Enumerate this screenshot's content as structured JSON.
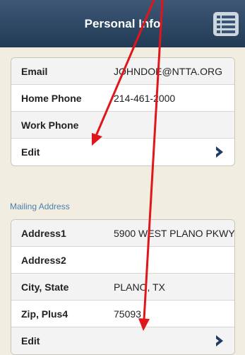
{
  "header": {
    "title": "Personal Info",
    "menu_icon": "list-menu-icon"
  },
  "contact": {
    "rows": [
      {
        "label": "Email",
        "value": "JOHNDOE@NTTA.ORG"
      },
      {
        "label": "Home Phone",
        "value": "214-461-2000"
      },
      {
        "label": "Work Phone",
        "value": ""
      }
    ],
    "edit_label": "Edit"
  },
  "mailing": {
    "section_title": "Mailing Address",
    "rows": [
      {
        "label": "Address1",
        "value": "5900 WEST PLANO PKWY"
      },
      {
        "label": "Address2",
        "value": ""
      },
      {
        "label": "City, State",
        "value": "PLANO, TX"
      },
      {
        "label": "Zip, Plus4",
        "value": "75093"
      }
    ],
    "edit_label": "Edit"
  },
  "colors": {
    "nav_bar": "#2b4561",
    "background": "#f2ede1",
    "accent_chevron": "#1f3d63",
    "section_header": "#4a7fb0",
    "annotation_arrows": "#e0161a"
  }
}
